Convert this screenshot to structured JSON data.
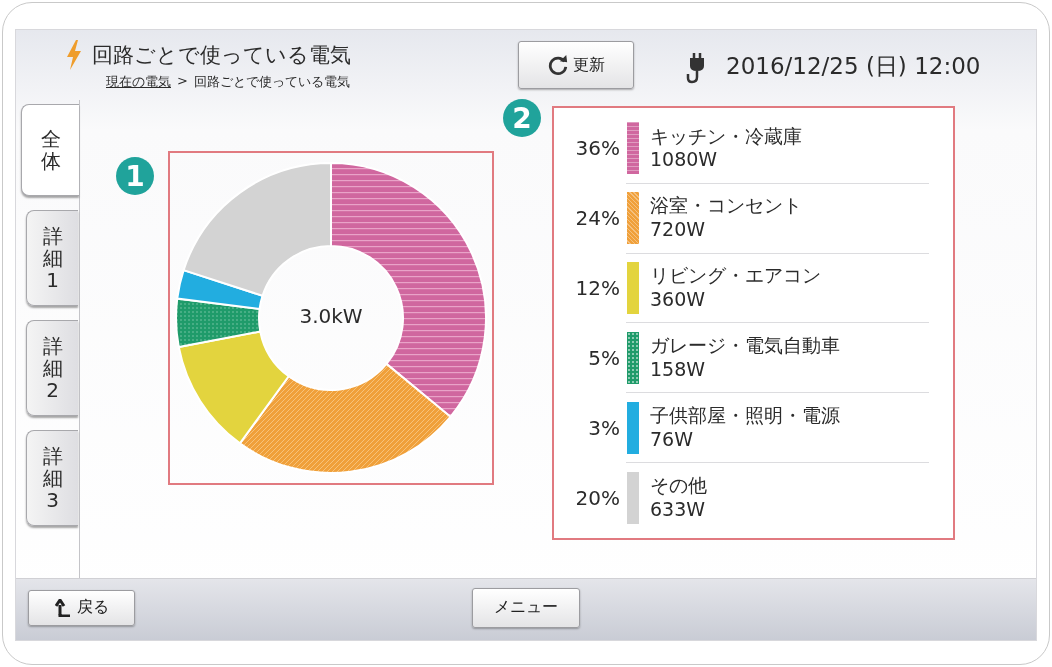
{
  "header": {
    "title": "回路ごとで使っている電気",
    "breadcrumb": {
      "link": "現在の電気",
      "separator": ">",
      "current": "回路ごとで使っている電気"
    },
    "refresh_button": "更新",
    "datetime": "2016/12/25 (日) 12:00"
  },
  "tabs": [
    {
      "label": "全体",
      "selected": true
    },
    {
      "label": "詳細1",
      "selected": false
    },
    {
      "label": "詳細2",
      "selected": false
    },
    {
      "label": "詳細3",
      "selected": false
    }
  ],
  "markers": [
    "1",
    "2"
  ],
  "chart": {
    "total": "3.0kW",
    "chart_data": {
      "type": "donut",
      "values": [
        36,
        24,
        12,
        5,
        3,
        20
      ]
    }
  },
  "legend": [
    {
      "percent": "36%",
      "name": "キッチン・冷蔵庫",
      "watts": "1080W",
      "color": "#d0679f",
      "kind": "stripes"
    },
    {
      "percent": "24%",
      "name": "浴室・コンセント",
      "watts": "720W",
      "color": "#f0a03a",
      "kind": "diagonal"
    },
    {
      "percent": "12%",
      "name": "リビング・エアコン",
      "watts": "360W",
      "color": "#e3d43e",
      "kind": "solid"
    },
    {
      "percent": "5%",
      "name": "ガレージ・電気自動車",
      "watts": "158W",
      "color": "#1f9b6a",
      "kind": "dots"
    },
    {
      "percent": "3%",
      "name": "子供部屋・照明・電源",
      "watts": "76W",
      "color": "#22ade0",
      "kind": "solid"
    },
    {
      "percent": "20%",
      "name": "その他",
      "watts": "633W",
      "color": "#d3d3d3",
      "kind": "solid"
    }
  ],
  "footer": {
    "back_button": "戻る",
    "menu_button": "メニュー"
  }
}
